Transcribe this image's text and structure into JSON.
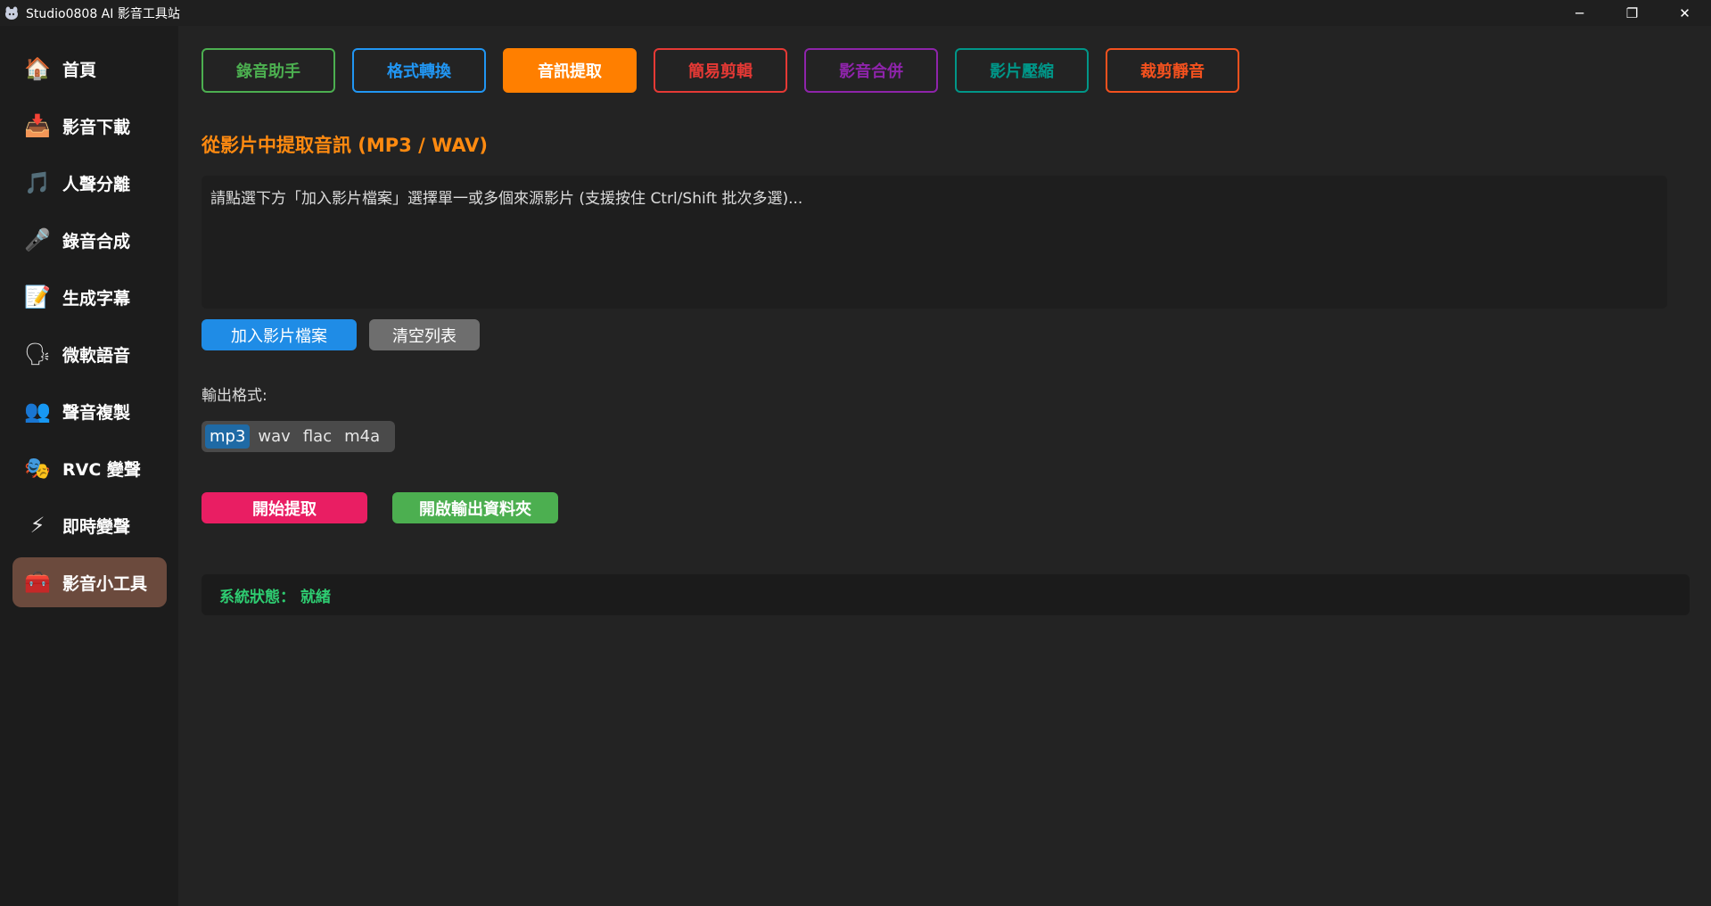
{
  "window": {
    "title": "Studio0808 AI 影音工具站",
    "controls": [
      "─",
      "❐",
      "✕"
    ]
  },
  "sidebar": {
    "active_index": 9,
    "items": [
      {
        "label": "首頁",
        "icon": "house-icon",
        "glyph": "🏠"
      },
      {
        "label": "影音下載",
        "icon": "download-icon",
        "glyph": "📥"
      },
      {
        "label": "人聲分離",
        "icon": "music-note-icon",
        "glyph": "🎵"
      },
      {
        "label": "錄音合成",
        "icon": "microphone-icon",
        "glyph": "🎤"
      },
      {
        "label": "生成字幕",
        "icon": "memo-icon",
        "glyph": "📝"
      },
      {
        "label": "微軟語音",
        "icon": "speaking-head-icon",
        "glyph": "🗣"
      },
      {
        "label": "聲音複製",
        "icon": "people-icon",
        "glyph": "👥"
      },
      {
        "label": "RVC 變聲",
        "icon": "masks-icon",
        "glyph": "🎭"
      },
      {
        "label": "即時變聲",
        "icon": "lightning-icon",
        "glyph": "⚡"
      },
      {
        "label": "影音小工具",
        "icon": "toolbox-icon",
        "glyph": "🧰"
      }
    ]
  },
  "tabs": [
    {
      "label": "錄音助手",
      "color": "#4caf50"
    },
    {
      "label": "格式轉換",
      "color": "#2196f3"
    },
    {
      "label": "音訊提取",
      "color": "#ff7f00"
    },
    {
      "label": "簡易剪輯",
      "color": "#e53935"
    },
    {
      "label": "影音合併",
      "color": "#8e24aa"
    },
    {
      "label": "影片壓縮",
      "color": "#009688"
    },
    {
      "label": "裁剪靜音",
      "color": "#f4511e"
    }
  ],
  "active_tab_index": 2,
  "main": {
    "title": "從影片中提取音訊 (MP3 / WAV)",
    "file_list_hint": "請點選下方「加入影片檔案」選擇單一或多個來源影片 (支援按住 Ctrl/Shift 批次多選)...",
    "add_button": "加入影片檔案",
    "clear_button": "清空列表",
    "format_label": "輸出格式:",
    "formats": [
      "mp3",
      "wav",
      "flac",
      "m4a"
    ],
    "selected_format": "mp3",
    "start_button": "開始提取",
    "open_folder_button": "開啟輸出資料夾",
    "status": "系統狀態： 就緒"
  }
}
